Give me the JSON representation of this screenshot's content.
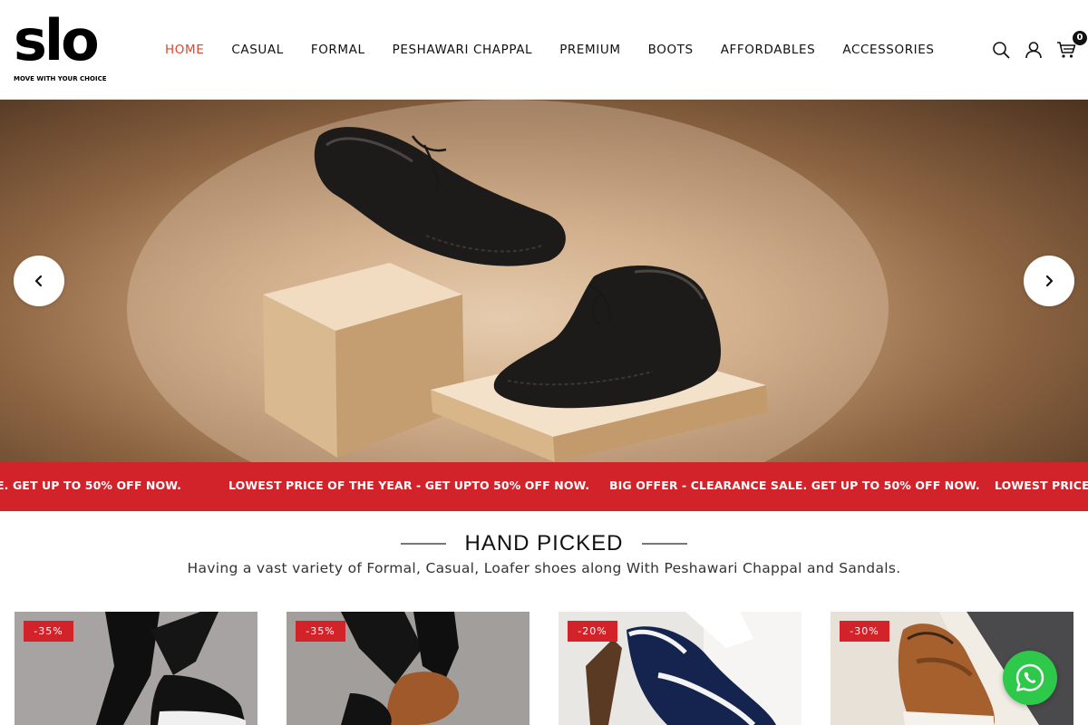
{
  "brand": {
    "logo_word": "slo",
    "tagline": "MOVE WITH YOUR CHOICE"
  },
  "nav": {
    "items": [
      "HOME",
      "CASUAL",
      "FORMAL",
      "PESHAWARI CHAPPAL",
      "PREMIUM",
      "BOOTS",
      "AFFORDABLES",
      "ACCESSORIES"
    ],
    "active": "HOME"
  },
  "header_icons": {
    "search": "search-icon",
    "account": "user-icon",
    "cart": "cart-icon",
    "cart_count": "0"
  },
  "hero": {
    "prev_icon": "chevron-left-icon",
    "next_icon": "chevron-right-icon"
  },
  "marquee": {
    "items": [
      "E. GET UP TO 50% OFF NOW.",
      "LOWEST PRICE OF THE YEAR - GET UPTO 50% OFF NOW.",
      "BIG OFFER - CLEARANCE SALE. GET UP TO 50% OFF NOW.",
      "LOWEST PRICE OF"
    ]
  },
  "section": {
    "title": "HAND PICKED",
    "subtitle": "Having a vast variety of Formal, Casual, Loafer shoes along With Peshawari Chappal and Sandals."
  },
  "products": [
    {
      "discount": "-35%"
    },
    {
      "discount": "-35%"
    },
    {
      "discount": "-20%"
    },
    {
      "discount": "-30%"
    }
  ],
  "colors": {
    "accent": "#e0452b",
    "sale_red": "#d2232a",
    "whatsapp": "#2ec84b"
  },
  "whatsapp": {
    "icon": "whatsapp-icon"
  }
}
